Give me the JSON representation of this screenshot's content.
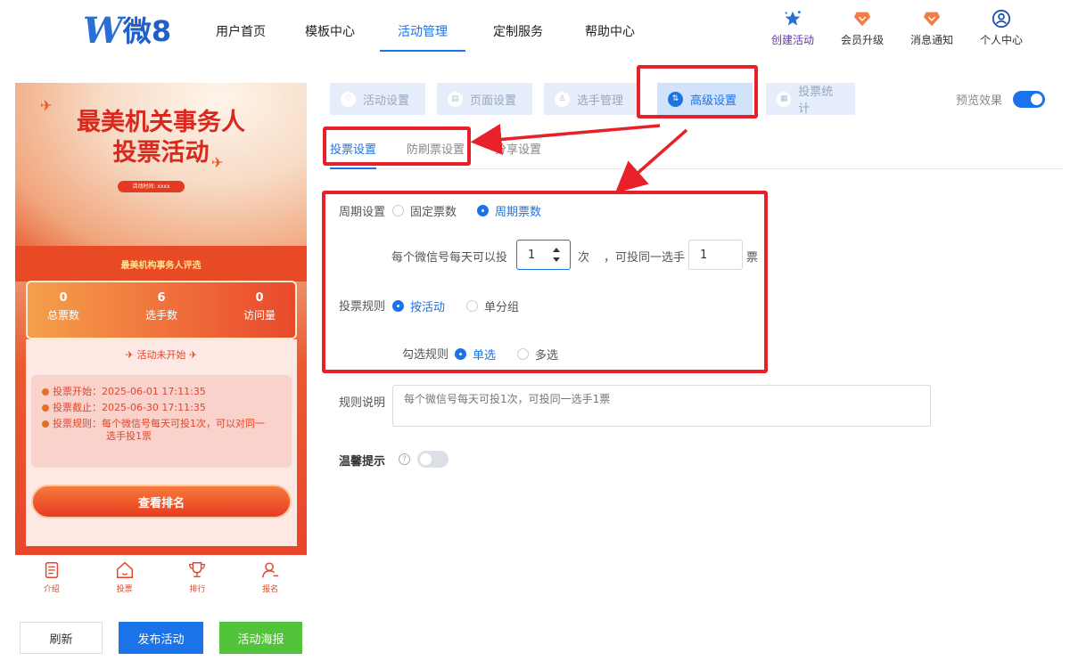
{
  "logo": {
    "mark": "W",
    "text": "微8"
  },
  "nav": {
    "items": [
      {
        "label": "用户首页"
      },
      {
        "label": "模板中心"
      },
      {
        "label": "活动管理"
      },
      {
        "label": "定制服务"
      },
      {
        "label": "帮助中心"
      }
    ],
    "active": "活动管理"
  },
  "right_nav": [
    {
      "label": "创建活动",
      "icon": "star-icon"
    },
    {
      "label": "会员升级",
      "icon": "diamond-icon"
    },
    {
      "label": "消息通知",
      "icon": "bell-icon"
    },
    {
      "label": "个人中心",
      "icon": "user-icon"
    }
  ],
  "preview_phone": {
    "title_line1": "最美机关事务人",
    "title_line2": "投票活动",
    "time_label": "活动时间: xxxx",
    "band_text": "最美机构事务人评选",
    "stats": [
      {
        "value": "0",
        "label": "总票数"
      },
      {
        "value": "6",
        "label": "选手数"
      },
      {
        "value": "0",
        "label": "访问量"
      }
    ],
    "status": "活动未开始",
    "vote_start": "投票开始：2025-06-01 17:11:35",
    "vote_end": "投票截止：2025-06-30 17:11:35",
    "vote_rule": "投票规则：每个微信号每天可投1次，可以对同一",
    "vote_rule_cont": "选手投1票",
    "rank_button": "查看排名",
    "tabbar": [
      {
        "label": "介绍",
        "icon": "document-icon"
      },
      {
        "label": "投票",
        "icon": "home-icon"
      },
      {
        "label": "排行",
        "icon": "trophy-icon"
      },
      {
        "label": "报名",
        "icon": "user-add-icon"
      }
    ]
  },
  "bottom_buttons": {
    "refresh": "刷新",
    "publish": "发布活动",
    "poster": "活动海报"
  },
  "steps": [
    {
      "label": "活动设置",
      "icon": "heart-icon"
    },
    {
      "label": "页面设置",
      "icon": "page-icon"
    },
    {
      "label": "选手管理",
      "icon": "person-icon"
    },
    {
      "label": "高级设置",
      "icon": "sliders-icon"
    },
    {
      "label": "投票统计",
      "icon": "stats-icon"
    }
  ],
  "active_step": "高级设置",
  "preview_toggle": {
    "label": "预览效果",
    "on": true
  },
  "sub_tabs": [
    {
      "label": "投票设置"
    },
    {
      "label": "防刷票设置"
    },
    {
      "label": "分享设置"
    }
  ],
  "form": {
    "cycle_label": "周期设置",
    "cycle_options": [
      "固定票数",
      "周期票数"
    ],
    "cycle_selected": "周期票数",
    "per_day_label": "每个微信号每天可以投",
    "per_day_value": "1",
    "times_unit": "次",
    "same_player_label": "，可投同一选手",
    "same_player_value": "1",
    "votes_unit": "票",
    "rule_label": "投票规则",
    "rule_options": [
      "按活动",
      "单分组"
    ],
    "rule_selected": "按活动",
    "check_label": "勾选规则",
    "check_options": [
      "单选",
      "多选"
    ],
    "check_selected": "单选",
    "desc_label": "规则说明",
    "desc_placeholder": "每个微信号每天可投1次，可投同一选手1票",
    "tips_label": "温馨提示",
    "tips_on": false
  },
  "colors": {
    "accent": "#1a73e8",
    "annotation": "#e8202a",
    "publish": "#1a73e8",
    "poster": "#52c33a"
  }
}
